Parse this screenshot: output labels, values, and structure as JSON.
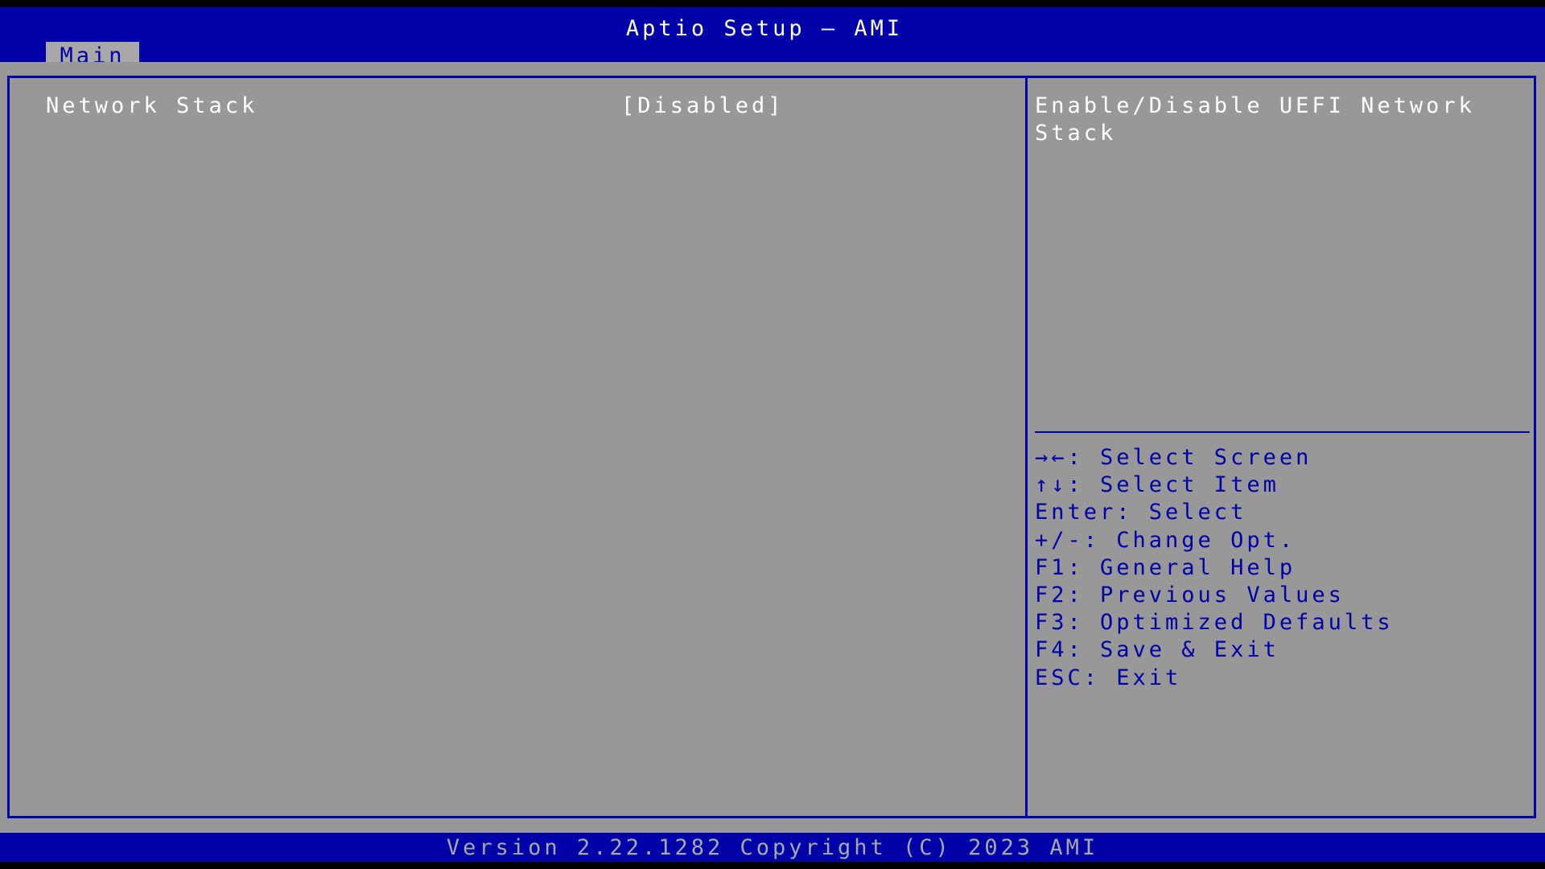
{
  "header": {
    "title": "Aptio Setup – AMI",
    "tabs": [
      {
        "label": "Main",
        "active": true
      }
    ]
  },
  "settings": [
    {
      "label": "Network Stack",
      "value": "[Disabled]"
    }
  ],
  "help_text": "Enable/Disable UEFI Network Stack",
  "key_help": [
    "→←: Select Screen",
    "↑↓: Select Item",
    "Enter: Select",
    "+/-: Change Opt.",
    "F1: General Help",
    "F2: Previous Values",
    "F3: Optimized Defaults",
    "F4: Save & Exit",
    "ESC: Exit"
  ],
  "footer": {
    "text": "Version 2.22.1282 Copyright (C) 2023 AMI"
  },
  "colors": {
    "bios_blue": "#0000a8",
    "panel_gray": "#989898",
    "tab_gray": "#a8a8a8"
  }
}
